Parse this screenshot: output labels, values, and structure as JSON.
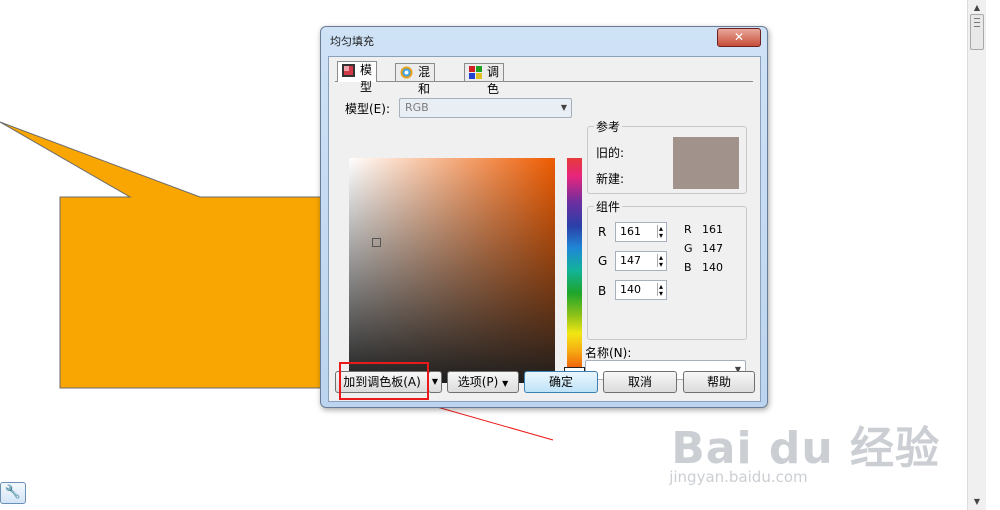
{
  "colors": {
    "callout_fill": "#f9a602",
    "reference_swatch": "#a1938c",
    "annotation_red": "#ea1a1a"
  },
  "dialog": {
    "title": "均匀填充",
    "close_label": "✕",
    "tabs": [
      {
        "label": "模型",
        "icon": "model-icon"
      },
      {
        "label": "混和器",
        "icon": "mixer-icon"
      },
      {
        "label": "调色板",
        "icon": "palette-icon"
      }
    ],
    "model": {
      "label": "模型(E):",
      "value": "RGB"
    },
    "reference": {
      "title": "参考",
      "old_label": "旧的:",
      "new_label": "新建:"
    },
    "components": {
      "title": "组件",
      "inputs": [
        {
          "label": "R",
          "value": "161"
        },
        {
          "label": "G",
          "value": "147"
        },
        {
          "label": "B",
          "value": "140"
        }
      ],
      "summary": [
        {
          "label": "R",
          "value": "161"
        },
        {
          "label": "G",
          "value": "147"
        },
        {
          "label": "B",
          "value": "140"
        }
      ]
    },
    "name": {
      "label": "名称(N):",
      "value": ""
    },
    "buttons": {
      "add_to_palette": "加到调色板(A)",
      "options": "选项(P)",
      "ok": "确定",
      "cancel": "取消",
      "help": "帮助"
    }
  },
  "watermark": {
    "brand": "Bai du 经验",
    "url": "jingyan.baidu.com"
  }
}
